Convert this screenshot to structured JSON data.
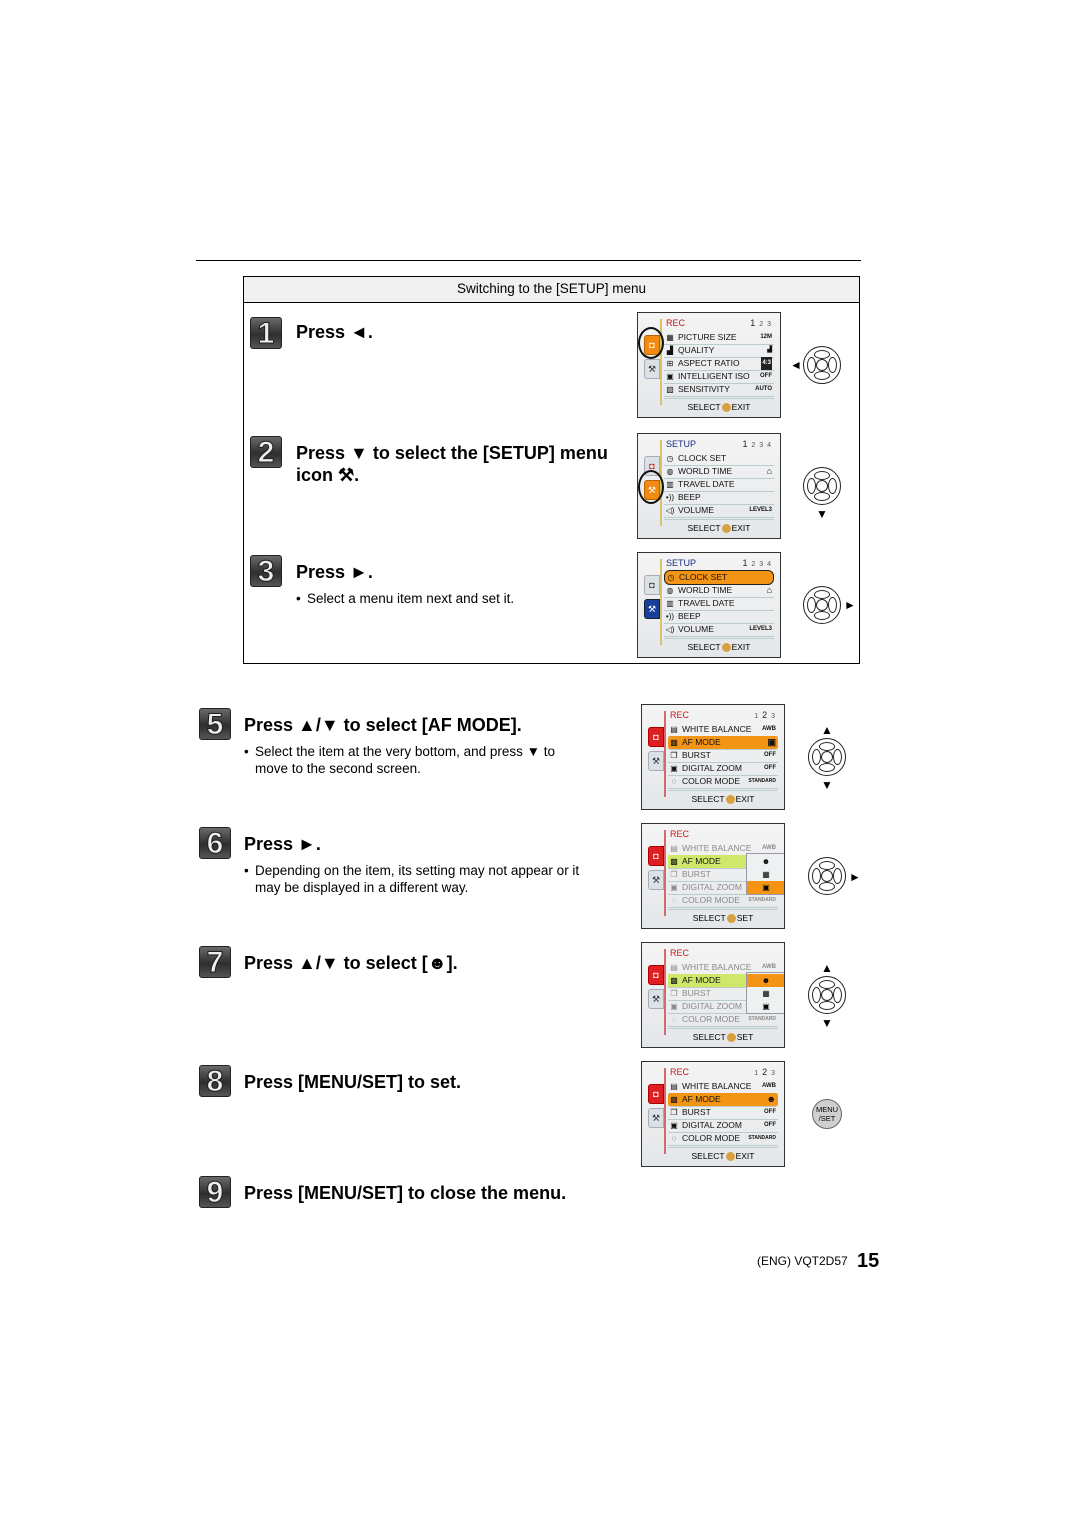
{
  "setup_box": {
    "header": "Switching to the [SETUP] menu"
  },
  "steps": [
    {
      "num": "1",
      "heading": "Press ◄.",
      "note": ""
    },
    {
      "num": "2",
      "heading_line1": "Press ▼ to select the [SETUP] menu",
      "heading_line2": "icon ",
      "icon": "wrench-icon",
      "note": ""
    },
    {
      "num": "3",
      "heading": "Press ►.",
      "note": "Select a menu item next and set it."
    },
    {
      "num": "5",
      "heading": "Press ▲/▼ to select [AF MODE].",
      "note_line1": "Select the item at the very bottom, and press ▼ to",
      "note_line2": "move to the second screen."
    },
    {
      "num": "6",
      "heading": "Press ►.",
      "note_line1": "Depending on the item, its setting may not appear or it",
      "note_line2": "may be displayed in a different way."
    },
    {
      "num": "7",
      "heading_prefix": "Press ▲/▼ to select [",
      "heading_suffix": "].",
      "icon": "face-detection-icon"
    },
    {
      "num": "8",
      "heading": "Press [MENU/SET] to set."
    },
    {
      "num": "9",
      "heading": "Press [MENU/SET] to close the menu."
    }
  ],
  "screens": {
    "rec1": {
      "title": "REC",
      "page_current": "1",
      "page_rest": "2 3",
      "rows": [
        {
          "icon": "▦",
          "label": "PICTURE SIZE",
          "value": "12M"
        },
        {
          "icon": "▟",
          "label": "QUALITY",
          "value": "▟"
        },
        {
          "icon": "⊞",
          "label": "ASPECT RATIO",
          "value": "4:3"
        },
        {
          "icon": "▣",
          "label": "INTELLIGENT ISO",
          "value": "OFF"
        },
        {
          "icon": "▧",
          "label": "SENSITIVITY",
          "value": "AUTO"
        }
      ],
      "footer_left": "SELECT",
      "footer_right": "EXIT"
    },
    "setup": {
      "title": "SETUP",
      "page_current": "1",
      "page_rest": "2 3 4",
      "rows": [
        {
          "icon": "◷",
          "label": "CLOCK SET",
          "value": ""
        },
        {
          "icon": "◍",
          "label": "WORLD TIME",
          "value": "⌂"
        },
        {
          "icon": "▥",
          "label": "TRAVEL DATE",
          "value": ""
        },
        {
          "icon": "•))",
          "label": "BEEP",
          "value": ""
        },
        {
          "icon": "◁)",
          "label": "VOLUME",
          "value": "LEVEL3"
        }
      ],
      "footer_left": "SELECT",
      "footer_right": "EXIT"
    },
    "rec2": {
      "title": "REC",
      "page_current": "2",
      "page_first": "1",
      "page_last": "3",
      "rows": [
        {
          "icon": "▤",
          "label": "WHITE BALANCE",
          "value": "AWB"
        },
        {
          "icon": "▩",
          "label": "AF MODE",
          "value": "▣"
        },
        {
          "icon": "❐",
          "label": "BURST",
          "value": "OFF"
        },
        {
          "icon": "▣",
          "label": "DIGITAL ZOOM",
          "value": "OFF"
        },
        {
          "icon": "◌",
          "label": "COLOR MODE",
          "value": "STANDARD"
        }
      ],
      "submenu": [
        "☻",
        "▦",
        "▣"
      ],
      "footer_left": "SELECT",
      "footer_right": "EXIT",
      "footer_set": "SET"
    },
    "rec2_final": {
      "af_value": "☻"
    }
  },
  "buttons": {
    "menu_set_line1": "MENU",
    "menu_set_line2": "/SET"
  },
  "arrows": {
    "left": "◄",
    "right": "►",
    "up": "▲",
    "down": "▼"
  },
  "footer": {
    "code": "(ENG) VQT2D57",
    "page_number": "15"
  },
  "colors": {
    "highlight_orange": "#f39414",
    "highlight_green": "#cfe86a",
    "rec_red": "#c81818",
    "tab_blue": "#1a3f9a"
  }
}
